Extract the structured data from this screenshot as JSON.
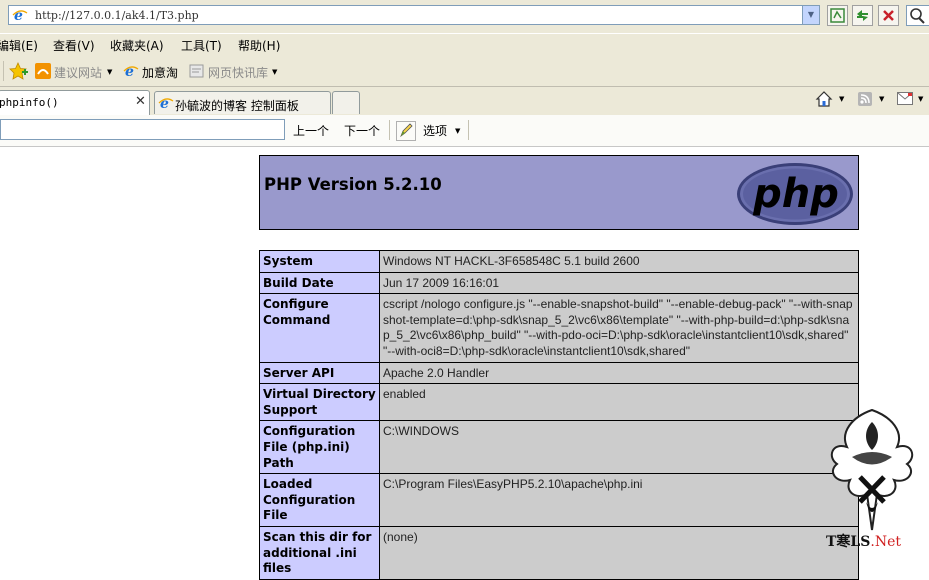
{
  "browser": {
    "address": "http://127.0.0.1/ak4.1/T3.php",
    "menu": [
      "编辑(E)",
      "查看(V)",
      "收藏夹(A)",
      "工具(T)",
      "帮助(H)"
    ],
    "links": [
      "建议网站",
      "加意淘",
      "网页快讯库"
    ],
    "tabs": [
      {
        "label": "phpinfo()",
        "active": true
      },
      {
        "label": "孙毓波的博客 控制面板",
        "active": false
      }
    ],
    "find": {
      "prev": "上一个",
      "next": "下一个",
      "options": "选项"
    }
  },
  "page": {
    "header_title": "PHP Version 5.2.10",
    "logo_text": "php",
    "rows": [
      {
        "label": "System",
        "value": "Windows NT HACKL-3F658548C 5.1 build 2600"
      },
      {
        "label": "Build Date",
        "value": "Jun 17 2009 16:16:01"
      },
      {
        "label": "Configure Command",
        "value": "cscript /nologo configure.js \"--enable-snapshot-build\" \"--enable-debug-pack\" \"--with-snapshot-template=d:\\php-sdk\\snap_5_2\\vc6\\x86\\template\" \"--with-php-build=d:\\php-sdk\\snap_5_2\\vc6\\x86\\php_build\" \"--with-pdo-oci=D:\\php-sdk\\oracle\\instantclient10\\sdk,shared\" \"--with-oci8=D:\\php-sdk\\oracle\\instantclient10\\sdk,shared\""
      },
      {
        "label": "Server API",
        "value": "Apache 2.0 Handler"
      },
      {
        "label": "Virtual Directory Support",
        "value": "enabled"
      },
      {
        "label": "Configuration File (php.ini) Path",
        "value": "C:\\WINDOWS"
      },
      {
        "label": "Loaded Configuration File",
        "value": "C:\\Program Files\\EasyPHP5.2.10\\apache\\php.ini"
      },
      {
        "label": "Scan this dir for additional .ini files",
        "value": "(none)"
      }
    ]
  },
  "watermark": {
    "text_main": "T寒LS",
    "text_suffix": ".Net"
  }
}
